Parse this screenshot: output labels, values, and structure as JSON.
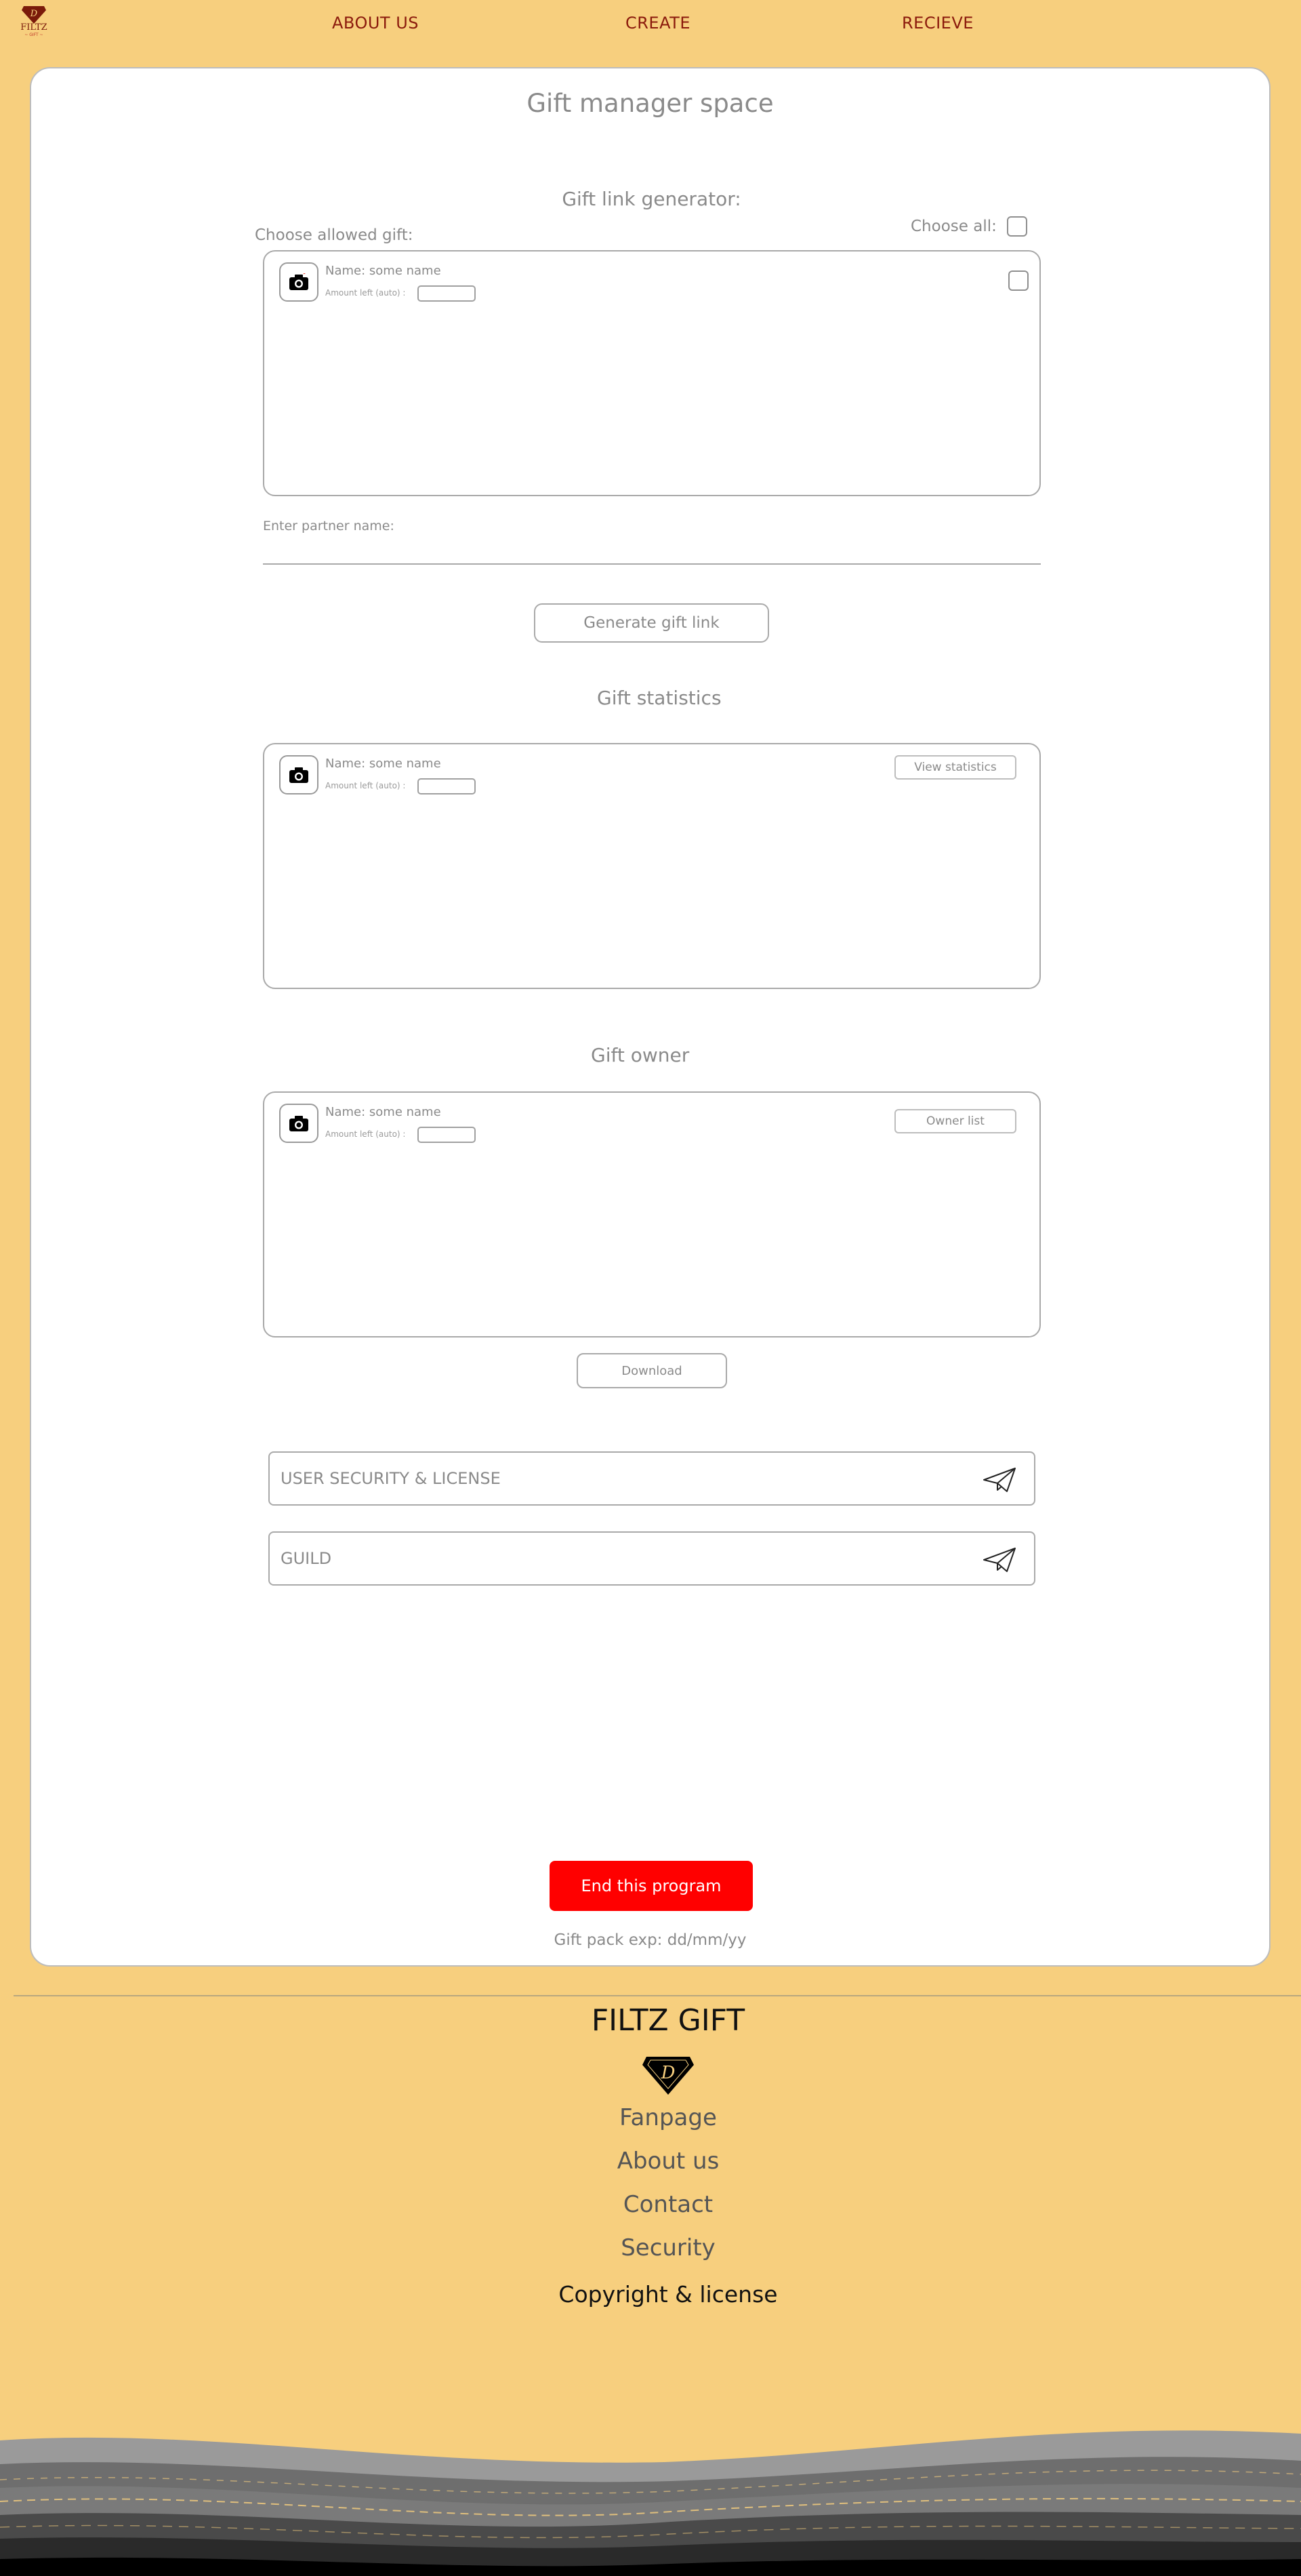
{
  "nav": {
    "logo_text": "FILTZ",
    "logo_sub": "~ GIFT ~",
    "links": [
      {
        "label": "ABOUT US"
      },
      {
        "label": "CREATE"
      },
      {
        "label": "RECIEVE"
      }
    ]
  },
  "card": {
    "title": "Gift manager space",
    "generator": {
      "heading": "Gift link generator:",
      "choose_allowed": "Choose allowed gift:",
      "choose_all": "Choose all:",
      "item": {
        "name": "Name: some name",
        "amount_label": "Amount left (auto) :"
      },
      "partner_label": "Enter partner name:",
      "generate_button": "Generate gift link"
    },
    "statistics": {
      "heading": "Gift statistics",
      "item": {
        "name": "Name: some name",
        "amount_label": "Amount left (auto) :"
      },
      "view_button": "View statistics"
    },
    "owner": {
      "heading": "Gift owner",
      "item": {
        "name": "Name: some name",
        "amount_label": "Amount left (auto) :"
      },
      "owner_button": "Owner list",
      "download_button": "Download"
    },
    "fields": {
      "security_placeholder": "USER SECURITY & LICENSE",
      "guild_placeholder": "GUILD"
    },
    "end_button": "End this program",
    "expiry": "Gift pack exp: dd/mm/yy"
  },
  "footer": {
    "title": "FILTZ GIFT",
    "links": [
      {
        "label": "Fanpage"
      },
      {
        "label": "About us"
      },
      {
        "label": "Contact"
      },
      {
        "label": "Security"
      }
    ],
    "copyright": "Copyright & license"
  },
  "colors": {
    "background": "#f7cf7e",
    "nav_link": "#8b1a0c",
    "end_button": "#ff0000"
  }
}
